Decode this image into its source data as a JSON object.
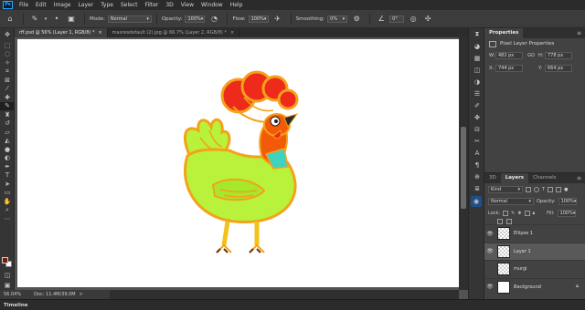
{
  "app": {
    "logo": "Ps"
  },
  "menu": [
    "File",
    "Edit",
    "Image",
    "Layer",
    "Type",
    "Select",
    "Filter",
    "3D",
    "View",
    "Window",
    "Help"
  ],
  "options": {
    "mode_label": "Mode:",
    "mode_value": "Normal",
    "opacity_label": "Opacity:",
    "opacity_value": "100%",
    "flow_label": "Flow:",
    "flow_value": "100%",
    "smoothing_label": "Smoothing:",
    "smoothing_value": "0%",
    "angle_value": "0°"
  },
  "tabs": [
    {
      "label": "rff.psd @ 56% (Layer 1, RGB/8) *",
      "close": "×"
    },
    {
      "label": "maxresdefault (2).jpg @ 66.7% (Layer 2, RGB/8) *",
      "close": "×"
    }
  ],
  "status": {
    "zoom": "56.04%",
    "doc": "Doc: 11.4M/39.0M",
    "arrow": ">"
  },
  "timeline_label": "Timeline",
  "properties": {
    "tab": "Properties",
    "title": "Pixel Layer Properties",
    "w_label": "W:",
    "w_value": "482 px",
    "h_label": "H:",
    "h_value": "778 px",
    "x_label": "X:",
    "x_value": "744 px",
    "y_label": "Y:",
    "y_value": "664 px",
    "link": "GO"
  },
  "layers_panel": {
    "tabs": [
      "3D",
      "Layers",
      "Channels"
    ],
    "kind": "Kind",
    "blend": "Normal",
    "opacity_label": "Opacity:",
    "opacity_value": "100%",
    "lock_label": "Lock:",
    "fill_label": "Fill:",
    "fill_value": "100%",
    "layers": [
      {
        "name": "Ellipse 1",
        "visible": true,
        "selected": false,
        "italic": false
      },
      {
        "name": "Layer 1",
        "visible": true,
        "selected": true,
        "italic": false
      },
      {
        "name": "murgi",
        "visible": false,
        "selected": false,
        "italic": false
      },
      {
        "name": "Background",
        "visible": true,
        "selected": false,
        "italic": true
      }
    ]
  },
  "colors": {
    "foreground": "#7a1f05",
    "background": "#ffffff",
    "body_green": "#b9f23a",
    "outline_orange": "#f4a21a",
    "comb_red": "#ee2a1a"
  }
}
